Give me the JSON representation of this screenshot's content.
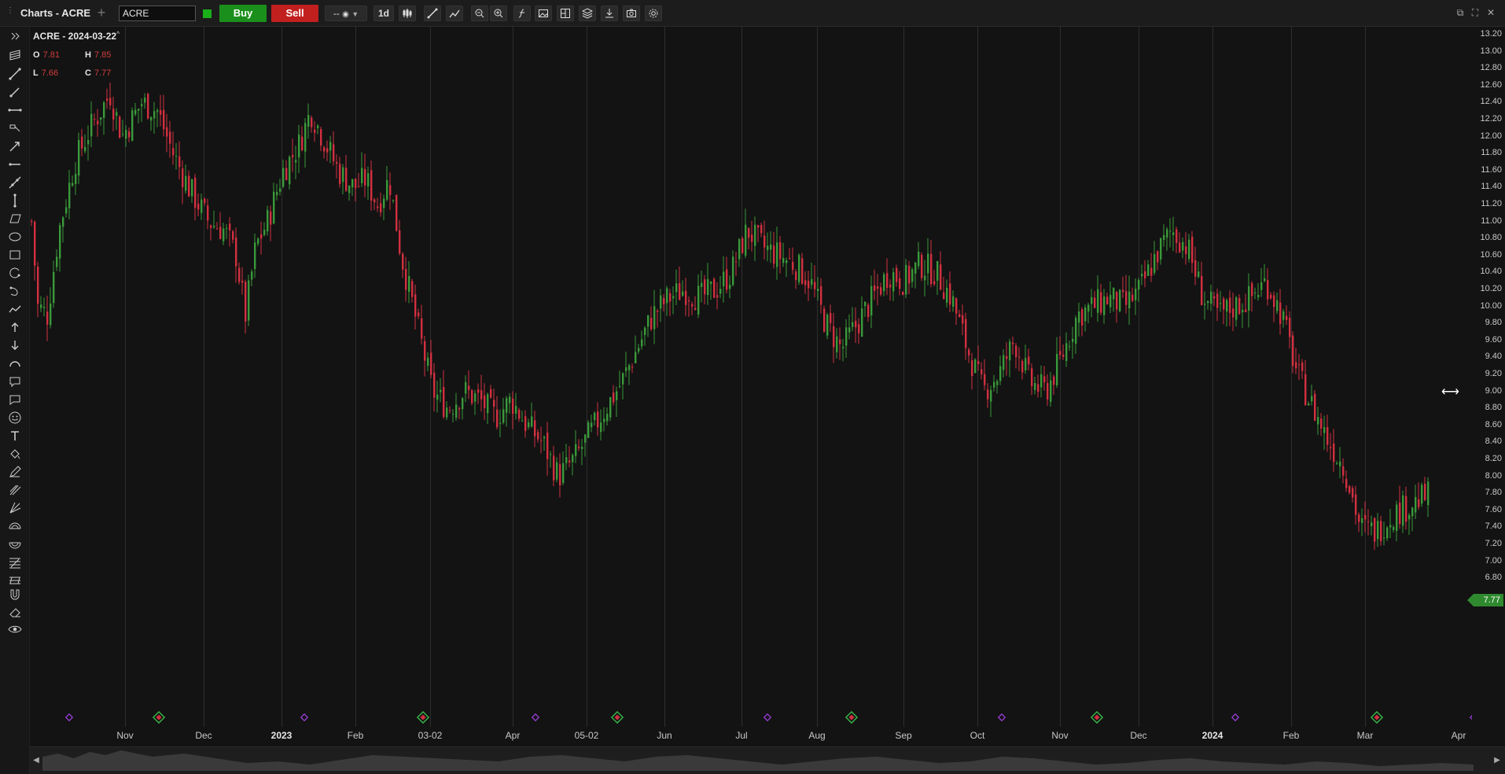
{
  "window": {
    "title": "Charts - ACRE",
    "symbol_value": "ACRE",
    "buy_label": "Buy",
    "sell_label": "Sell",
    "interval_label": "1d",
    "clock_label": "--"
  },
  "legend": {
    "title": "ACRE - 2024-03-22",
    "o_key": "O",
    "o_val": "7.81",
    "h_key": "H",
    "h_val": "7.85",
    "l_key": "L",
    "l_val": "7.66",
    "c_key": "C",
    "c_val": "7.77"
  },
  "y_axis": {
    "ticks": [
      "13.20",
      "13.00",
      "12.80",
      "12.60",
      "12.40",
      "12.20",
      "12.00",
      "11.80",
      "11.60",
      "11.40",
      "11.20",
      "11.00",
      "10.80",
      "10.60",
      "10.40",
      "10.20",
      "10.00",
      "9.80",
      "9.60",
      "9.40",
      "9.20",
      "9.00",
      "8.80",
      "8.60",
      "8.40",
      "8.20",
      "8.00",
      "7.80",
      "7.60",
      "7.40",
      "7.20",
      "7.00",
      "6.80"
    ],
    "last_price": "7.77"
  },
  "x_axis": {
    "labels": [
      {
        "text": "Nov",
        "bold": false
      },
      {
        "text": "Dec",
        "bold": false
      },
      {
        "text": "2023",
        "bold": true
      },
      {
        "text": "Feb",
        "bold": false
      },
      {
        "text": "03-02",
        "bold": false
      },
      {
        "text": "Apr",
        "bold": false
      },
      {
        "text": "05-02",
        "bold": false
      },
      {
        "text": "Jun",
        "bold": false
      },
      {
        "text": "Jul",
        "bold": false
      },
      {
        "text": "Aug",
        "bold": false
      },
      {
        "text": "Sep",
        "bold": false
      },
      {
        "text": "Oct",
        "bold": false
      },
      {
        "text": "Nov",
        "bold": false
      },
      {
        "text": "Dec",
        "bold": false
      },
      {
        "text": "2024",
        "bold": true
      },
      {
        "text": "Feb",
        "bold": false
      },
      {
        "text": "Mar",
        "bold": false
      },
      {
        "text": "Apr",
        "bold": false
      }
    ]
  },
  "colors": {
    "up": "#3a9a3a",
    "down": "#d23040",
    "dividend_marker": "#a040e0",
    "earnings_marker": "#38b048",
    "accent_green": "#1b8f1b",
    "accent_red": "#c21f1f"
  },
  "left_tools": [
    "expand-icon",
    "layers-icon",
    "trend-line-icon",
    "ray-icon",
    "horizontal-line-icon",
    "measure-icon",
    "arrow-line-icon",
    "horizontal-ray-icon",
    "extended-line-icon",
    "vertical-line-icon",
    "parallelogram-icon",
    "ellipse-icon",
    "rectangle-icon",
    "arc-icon",
    "curve-icon",
    "polyline-icon",
    "arrow-up-icon",
    "arrow-down-icon",
    "half-circle-icon",
    "callout-icon",
    "comment-icon",
    "emoji-icon",
    "text-icon",
    "paint-icon",
    "pencil-icon",
    "fork-icon",
    "fan-icon",
    "fib-arc-icon",
    "fib-circle-icon",
    "fib-retracement-icon",
    "fib-channel-icon",
    "magnet-icon",
    "eraser-icon",
    "eye-icon"
  ]
}
